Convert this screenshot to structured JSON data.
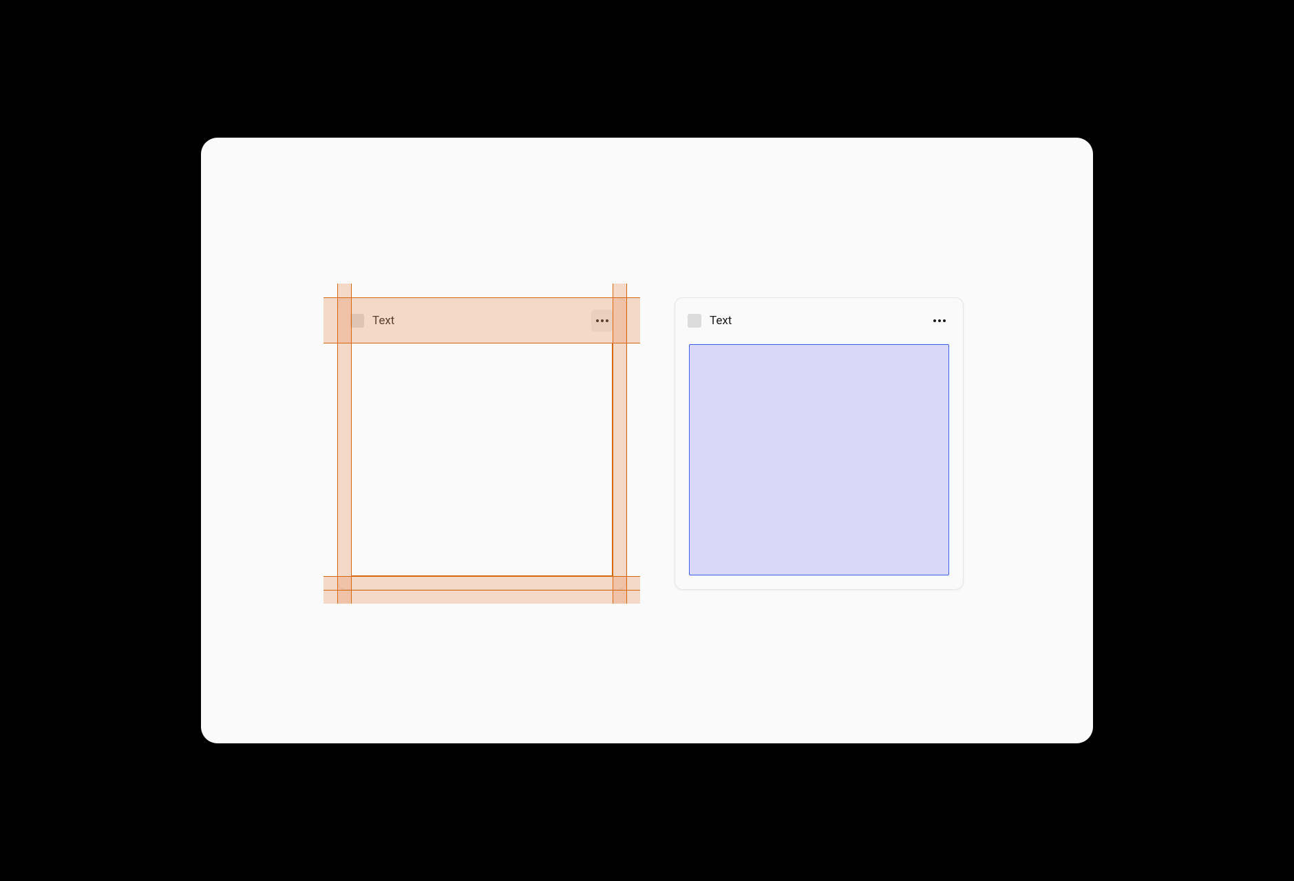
{
  "cards": {
    "left": {
      "title": "Text",
      "more_button_highlighted": true
    },
    "right": {
      "title": "Text",
      "more_button_highlighted": false,
      "body_selected": true
    }
  },
  "colors": {
    "guide": "#d6670c",
    "padding_fill": "rgba(232,141,90,0.3)",
    "selection_fill": "#d9d7fa",
    "selection_border": "#3a5ef0"
  }
}
